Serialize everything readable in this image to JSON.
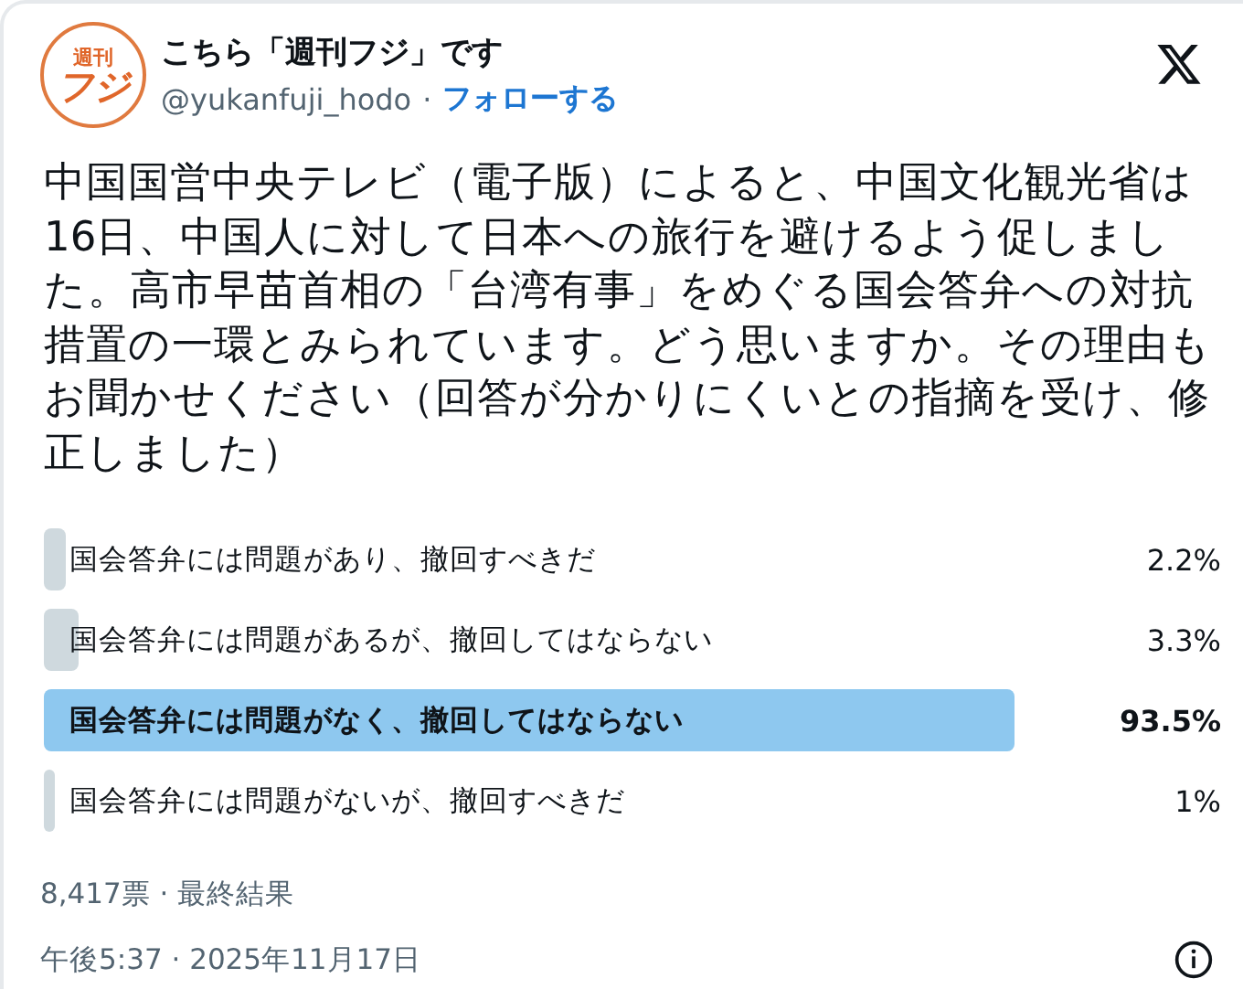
{
  "account": {
    "logo_top": "週刊",
    "logo_bottom": "フジ",
    "name": "こちら「週刊フジ」です",
    "handle": "@yukanfuji_hodo",
    "separator": "·",
    "follow": "フォローする"
  },
  "body": "中国国営中央テレビ（電子版）によると、中国文化観光省は16日、中国人に対して日本への旅行を避けるよう促しました。高市早苗首相の「台湾有事」をめぐる国会答弁への対抗措置の一環とみられています。どう思いますか。その理由もお聞かせください（回答が分かりにくいとの指摘を受け、修正しました）",
  "poll": [
    {
      "label": "国会答弁には問題があり、撤回すべきだ",
      "percent": "2.2%",
      "selected": false
    },
    {
      "label": "国会答弁には問題があるが、撤回してはならない",
      "percent": "3.3%",
      "selected": false
    },
    {
      "label": "国会答弁には問題がなく、撤回してはならない",
      "percent": "93.5%",
      "selected": true
    },
    {
      "label": "国会答弁には問題がないが、撤回すべきだ",
      "percent": "1%",
      "selected": false
    }
  ],
  "summary": "8,417票 · 最終結果",
  "timestamp": "午後5:37 · 2025年11月17日"
}
